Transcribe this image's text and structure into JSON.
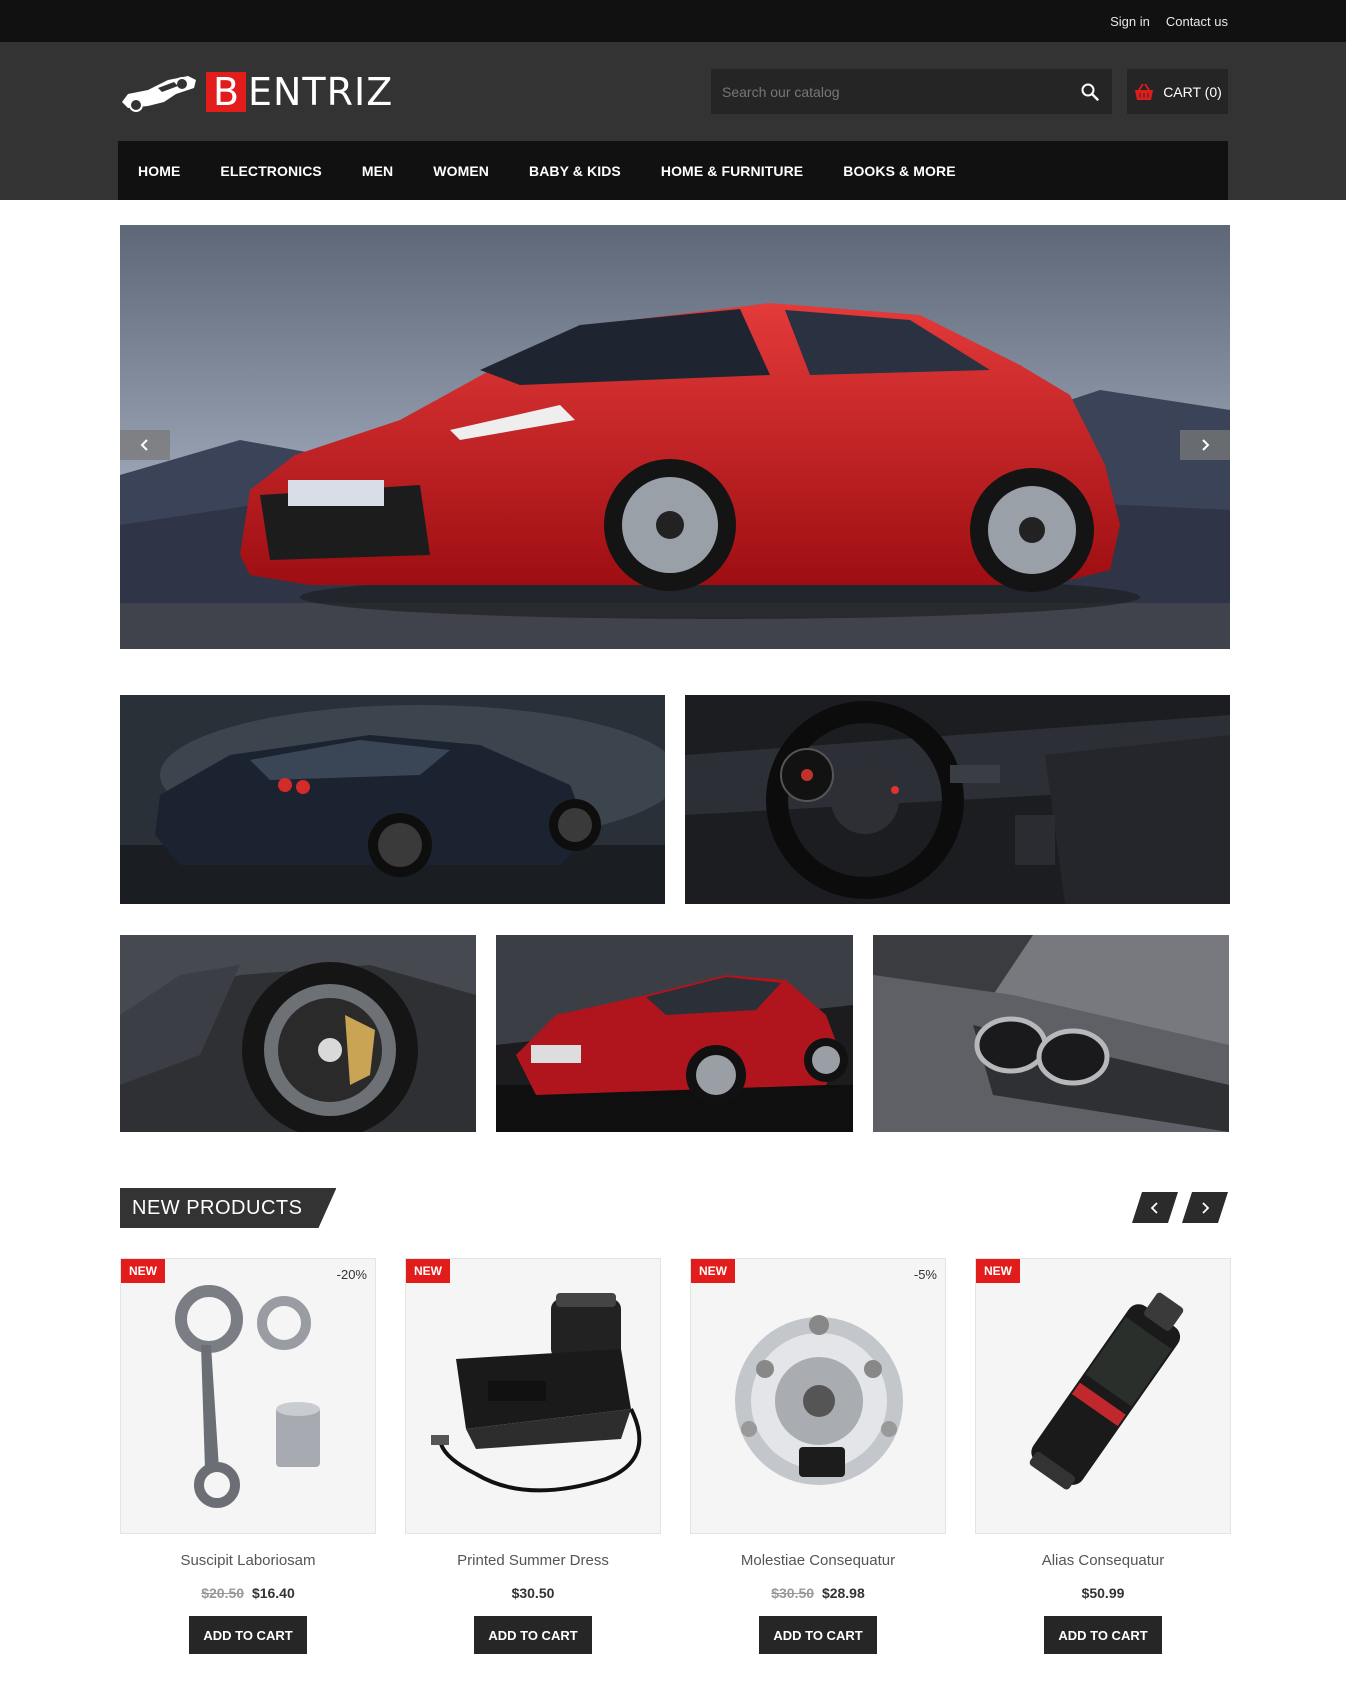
{
  "topbar": {
    "sign_in": "Sign in",
    "contact": "Contact us"
  },
  "logo": {
    "first_letter": "B",
    "rest": "ENTRIZ"
  },
  "search": {
    "placeholder": "Search our catalog"
  },
  "cart": {
    "label": "CART (0)"
  },
  "nav": [
    "HOME",
    "ELECTRONICS",
    "MEN",
    "WOMEN",
    "BABY & KIDS",
    "HOME & FURNITURE",
    "BOOKS & MORE"
  ],
  "section": {
    "title": "NEW PRODUCTS"
  },
  "products": [
    {
      "badge": "NEW",
      "discount": "-20%",
      "name": "Suscipit Laboriosam",
      "old_price": "$20.50",
      "price": "$16.40",
      "button": "ADD TO CART"
    },
    {
      "badge": "NEW",
      "discount": "",
      "name": "Printed Summer Dress",
      "old_price": "",
      "price": "$30.50",
      "button": "ADD TO CART"
    },
    {
      "badge": "NEW",
      "discount": "-5%",
      "name": "Molestiae Consequatur",
      "old_price": "$30.50",
      "price": "$28.98",
      "button": "ADD TO CART"
    },
    {
      "badge": "NEW",
      "discount": "",
      "name": "Alias Consequatur",
      "old_price": "",
      "price": "$50.99",
      "button": "ADD TO CART"
    }
  ],
  "colors": {
    "accent": "#e21b1b",
    "dark": "#111111",
    "header": "#333333"
  },
  "icons": {
    "search": "search-icon",
    "cart": "basket-icon",
    "prev": "chevron-left-icon",
    "next": "chevron-right-icon"
  }
}
